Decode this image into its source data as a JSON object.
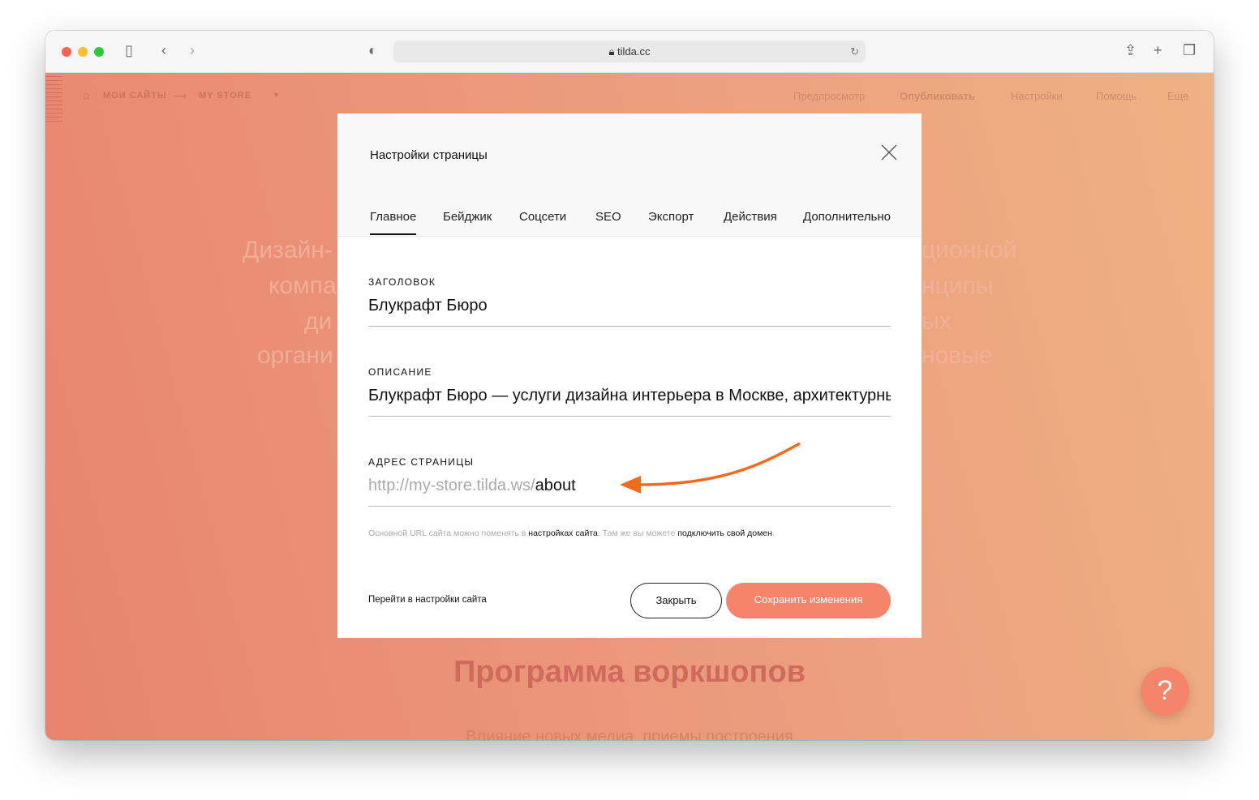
{
  "browser": {
    "url": "tilda.cc"
  },
  "header": {
    "crumbs": [
      "МОИ САЙТЫ",
      "MY STORE"
    ],
    "nav": [
      "Предпросмотр",
      "Опубликовать",
      "Настройки",
      "Помощь",
      "Еще"
    ]
  },
  "background": {
    "lines_left": [
      "Дизайн-",
      "компа",
      "ди",
      "органи"
    ],
    "lines_right": [
      "ционной",
      "нципы",
      "ых",
      "новые"
    ],
    "heading": "Программа воркшопов",
    "sub": "Влияние новых медиа, приемы построения"
  },
  "modal": {
    "title": "Настройки страницы",
    "tabs": [
      "Главное",
      "Бейджик",
      "Соцсети",
      "SEO",
      "Экспорт",
      "Действия",
      "Дополнительно"
    ],
    "fields": {
      "title_label": "ЗАГОЛОВОК",
      "title_value": "Блукрафт Бюро",
      "desc_label": "ОПИСАНИЕ",
      "desc_value": "Блукрафт Бюро — услуги дизайна интерьера в Москве, архитектурные",
      "url_label": "АДРЕС СТРАНИЦЫ",
      "url_prefix": "http://my-store.tilda.ws/",
      "url_value": "about"
    },
    "hint": {
      "t1": "Основной URL сайта можно поменять в ",
      "l1": "настройках сайта",
      "t2": ". Там же вы можете ",
      "l2": "подключить свой домен",
      "t3": "."
    },
    "site_settings_link": "Перейти в настройки сайта",
    "close_label": "Закрыть",
    "save_label": "Сохранить изменения"
  },
  "colors": {
    "accent": "#f4846a",
    "arrow": "#f26b1d"
  },
  "help_label": "?"
}
